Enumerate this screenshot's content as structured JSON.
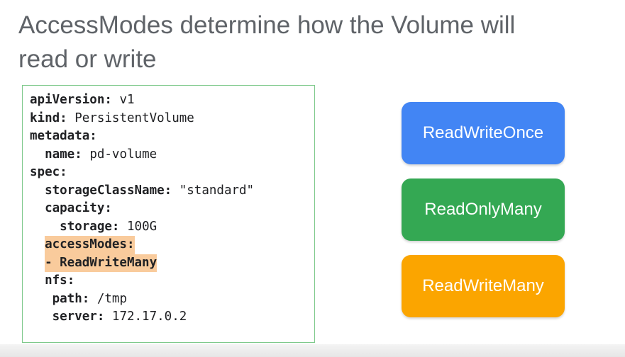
{
  "slide": {
    "title_line1": "AccessModes determine how the Volume will",
    "title_line2": "read or write"
  },
  "code": {
    "line1_key": "apiVersion",
    "line1_value": " v1",
    "line2_key": "kind",
    "line2_value": " PersistentVolume",
    "line3_key": "metadata",
    "line4_key": "name",
    "line4_value": " pd-volume",
    "line5_key": "spec",
    "line6_key": "storageClassName",
    "line6_value": " \"standard\"",
    "line7_key": "capacity",
    "line8_key": "storage",
    "line8_value": " 100G",
    "line9_highlight": "accessModes:",
    "line10_highlight": "- ReadWriteMany",
    "line11_key": "nfs",
    "line12_key": "path",
    "line12_value": " /tmp",
    "line13_key": "server",
    "line13_value": " 172.17.0.2"
  },
  "access_modes": [
    {
      "label": "ReadWriteOnce",
      "color": "#4285f4"
    },
    {
      "label": "ReadOnlyMany",
      "color": "#34a853"
    },
    {
      "label": "ReadWriteMany",
      "color": "#fba500"
    }
  ],
  "colors": {
    "title": "#5f6368",
    "code_box_border": "#7ec98b",
    "highlight": "#f9cb9c"
  }
}
